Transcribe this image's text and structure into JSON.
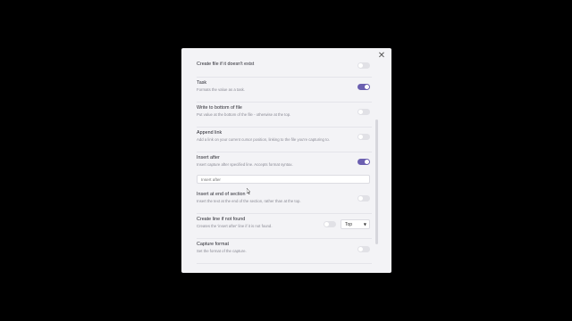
{
  "modal": {
    "close_icon": "✕",
    "settings": [
      {
        "name": "Create file if it doesn't exist",
        "description": "",
        "enabled": false
      },
      {
        "name": "Task",
        "description": "Formats the value as a task.",
        "enabled": true
      },
      {
        "name": "Write to bottom of file",
        "description": "Put value at the bottom of the file - otherwise at the top.",
        "enabled": false
      },
      {
        "name": "Append link",
        "description": "Add a link on your current cursor position, linking to the file you're capturing to.",
        "enabled": false
      },
      {
        "name": "Insert after",
        "description": "Insert capture after specified line. Accepts format syntax.",
        "enabled": true
      },
      {
        "name": "Insert at end of section",
        "description": "Insert the text at the end of the section, rather than at the top.",
        "enabled": false
      },
      {
        "name": "Create line if not found",
        "description": "Creates the 'insert after' line if it is not found.",
        "enabled": false
      },
      {
        "name": "Capture format",
        "description": "Set the format of the capture.",
        "enabled": false
      }
    ],
    "insert_after_input": {
      "placeholder": "Insert after",
      "value": ""
    },
    "create_line_select": {
      "value": "Top",
      "caret": "▼"
    }
  },
  "colors": {
    "backdrop": "#000000",
    "modal_bg": "#f3f3f6",
    "toggle_on": "#6b5fb0",
    "toggle_off": "#e1e1e6"
  }
}
